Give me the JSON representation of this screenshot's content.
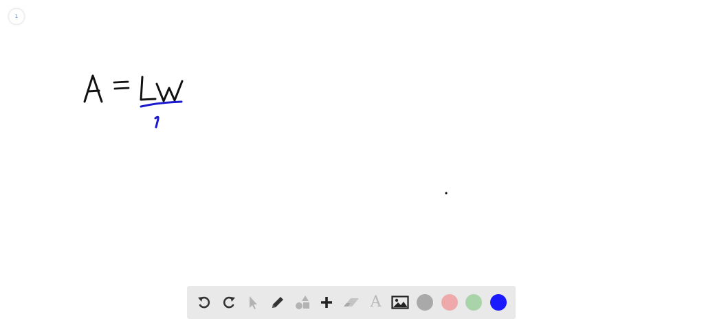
{
  "page": {
    "indicator_label": "1"
  },
  "toolbar": {
    "text_tool_glyph": "A",
    "colors": {
      "gray": "#a9a9a9",
      "pink": "#eeaaaa",
      "green": "#a9d3a9",
      "blue": "#1a1aff"
    },
    "tools": [
      {
        "name": "undo-icon",
        "enabled": true
      },
      {
        "name": "redo-icon",
        "enabled": true
      },
      {
        "name": "select-pointer-icon",
        "enabled": false
      },
      {
        "name": "pencil-icon",
        "enabled": true
      },
      {
        "name": "shapes-icon",
        "enabled": false
      },
      {
        "name": "plus-icon",
        "enabled": true
      },
      {
        "name": "eraser-icon",
        "enabled": false
      },
      {
        "name": "text-icon",
        "enabled": false
      },
      {
        "name": "image-icon",
        "enabled": true
      }
    ]
  },
  "drawing": {
    "equation_left": "A",
    "equation_equals": "=",
    "equation_right": "Lw",
    "annotation_mark": "1",
    "ink_color": "#111111",
    "highlight_color": "#1a1acc"
  }
}
